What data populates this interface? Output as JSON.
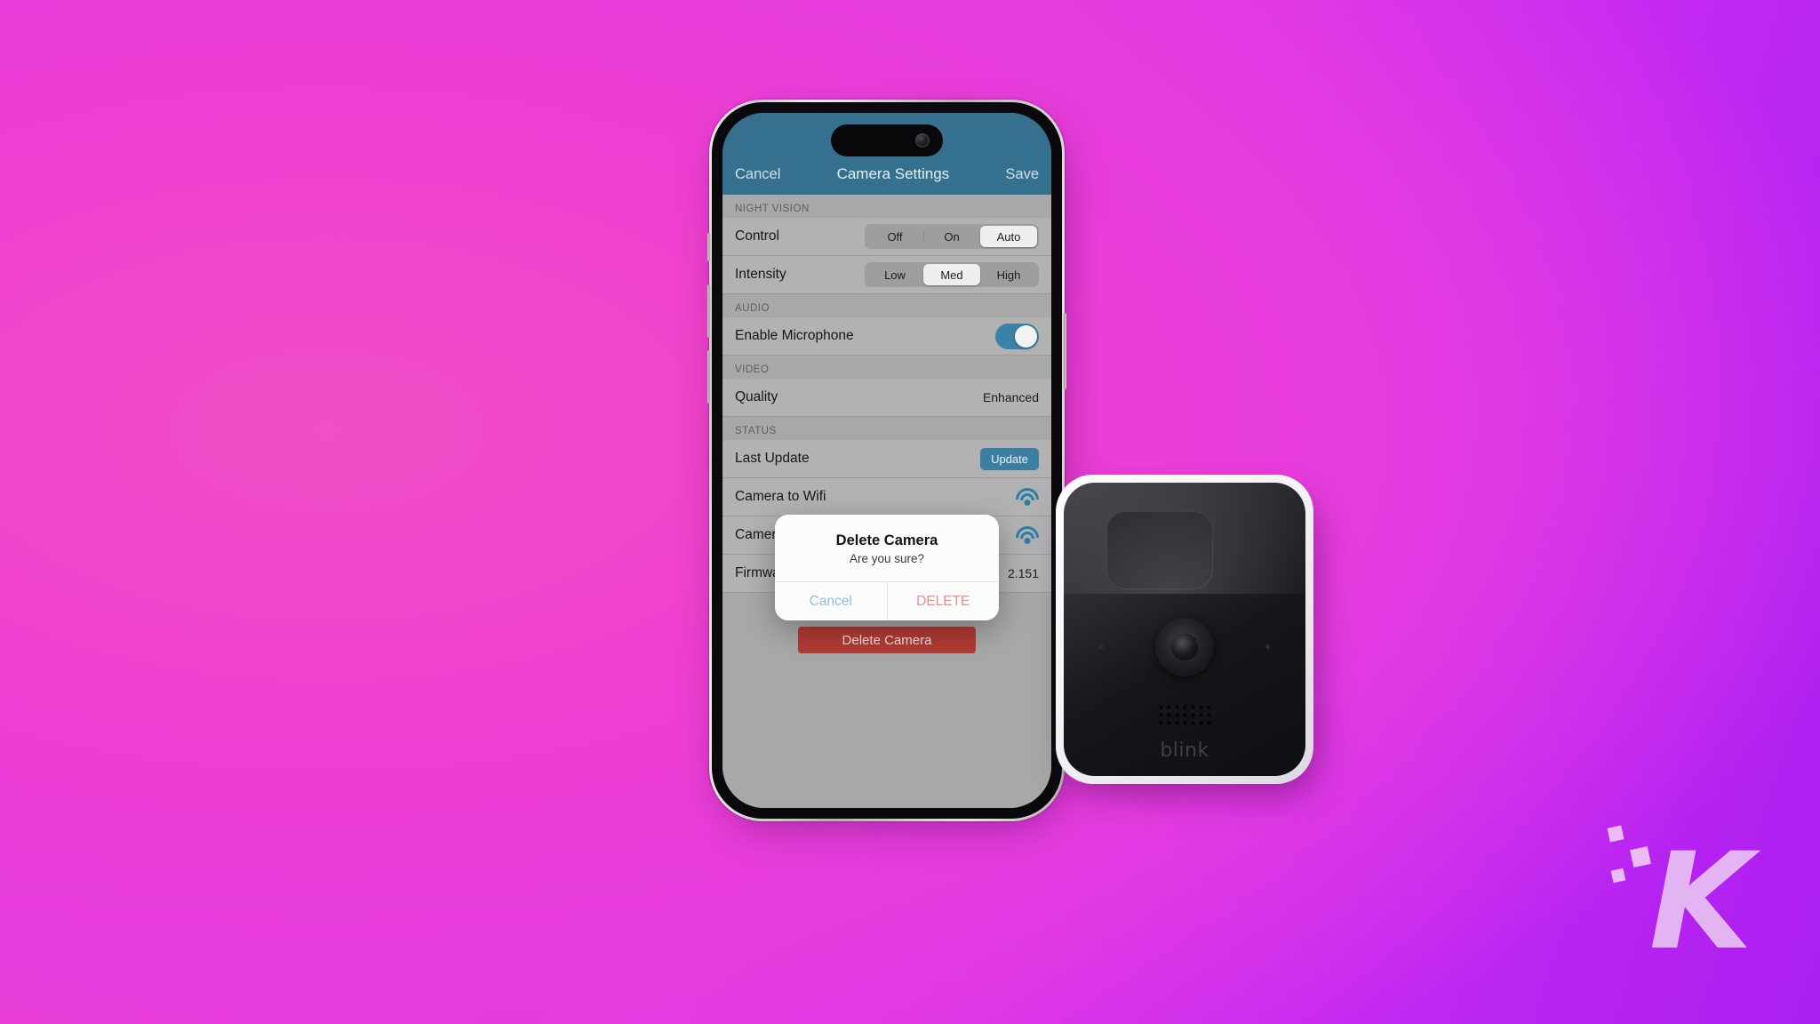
{
  "background": {
    "pink": "#e9479f",
    "magenta": "#e63ae6",
    "purple": "#aa1ff0"
  },
  "phone": {
    "nav": {
      "cancel_label": "Cancel",
      "title": "Camera Settings",
      "save_label": "Save",
      "bar_color": "#35718e"
    },
    "sections": [
      {
        "header": "NIGHT VISION",
        "rows": [
          {
            "label": "Control",
            "type": "segmented",
            "options": [
              "Off",
              "On",
              "Auto"
            ],
            "selected": "Auto"
          },
          {
            "label": "Intensity",
            "type": "segmented",
            "options": [
              "Low",
              "Med",
              "High"
            ],
            "selected": "Med"
          }
        ]
      },
      {
        "header": "AUDIO",
        "rows": [
          {
            "label": "Enable Microphone",
            "type": "toggle",
            "value": "on"
          }
        ]
      },
      {
        "header": "VIDEO",
        "rows": [
          {
            "label": "Quality",
            "type": "value",
            "value": "Enhanced"
          }
        ]
      },
      {
        "header": "STATUS",
        "rows": [
          {
            "label": "Last Update",
            "type": "button",
            "value": "Update"
          },
          {
            "label": "Camera to Wifi",
            "type": "wifi",
            "value": ""
          },
          {
            "label": "Camera to Sync Module",
            "type": "wifi",
            "value": ""
          },
          {
            "label": "Firmware",
            "type": "value",
            "value": "2.151"
          }
        ]
      }
    ],
    "delete_button_label": "Delete Camera",
    "alert": {
      "title": "Delete Camera",
      "message": "Are you sure?",
      "cancel_label": "Cancel",
      "confirm_label": "DELETE",
      "cancel_color": "#8fbede",
      "confirm_color": "#e78e8e"
    }
  },
  "camera_device": {
    "brand_logo": "blink"
  },
  "watermark": {
    "letter": "K"
  }
}
